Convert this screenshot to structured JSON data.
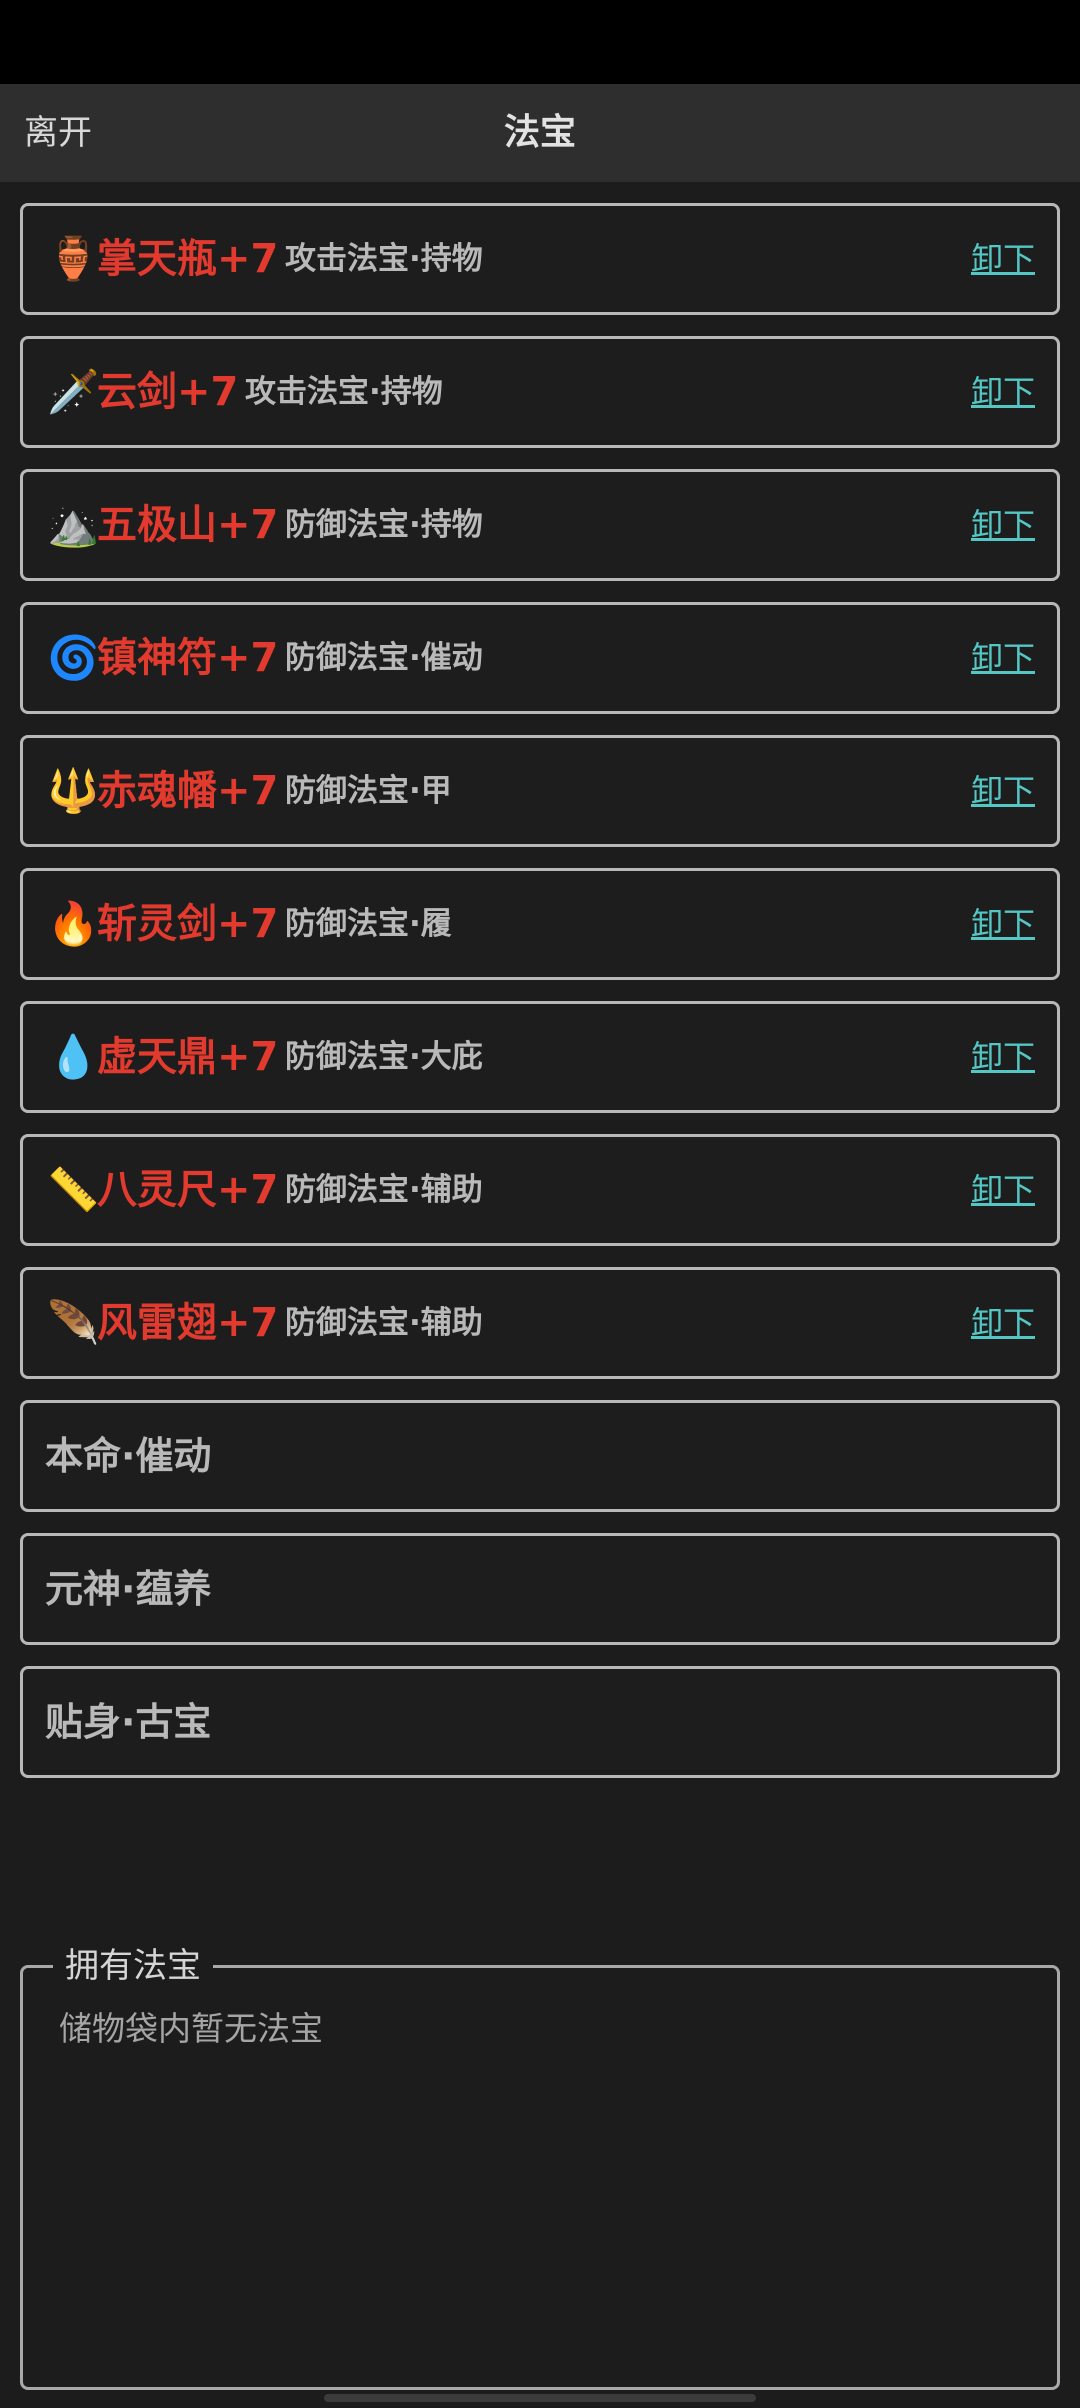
{
  "header": {
    "back_label": "离开",
    "title": "法宝"
  },
  "equipped": [
    {
      "icon": "🏺",
      "icon_name": "amphora-icon",
      "name": "掌天瓶+7",
      "type": "攻击法宝·持物",
      "action": "卸下"
    },
    {
      "icon": "🗡️",
      "icon_name": "dagger-icon",
      "name": "云剑+7",
      "type": "攻击法宝·持物",
      "action": "卸下"
    },
    {
      "icon": "⛰️",
      "icon_name": "mountain-icon",
      "name": "五极山+7",
      "type": "防御法宝·持物",
      "action": "卸下"
    },
    {
      "icon": "🌀",
      "icon_name": "cyclone-icon",
      "name": "镇神符+7",
      "type": "防御法宝·催动",
      "action": "卸下"
    },
    {
      "icon": "🔱",
      "icon_name": "trident-icon",
      "name": "赤魂幡+7",
      "type": "防御法宝·甲",
      "action": "卸下"
    },
    {
      "icon": "🔥",
      "icon_name": "fire-icon",
      "name": "斩灵剑+7",
      "type": "防御法宝·履",
      "action": "卸下"
    },
    {
      "icon": "💧",
      "icon_name": "droplet-icon",
      "name": "虚天鼎+7",
      "type": "防御法宝·大庇",
      "action": "卸下"
    },
    {
      "icon": "📏",
      "icon_name": "ruler-icon",
      "name": "八灵尺+7",
      "type": "防御法宝·辅助",
      "action": "卸下"
    },
    {
      "icon": "🪶",
      "icon_name": "feather-icon",
      "name": "风雷翅+7",
      "type": "防御法宝·辅助",
      "action": "卸下"
    }
  ],
  "empty_slots": [
    {
      "label": "本命·催动"
    },
    {
      "label": "元神·蕴养"
    },
    {
      "label": "贴身·古宝"
    }
  ],
  "owned": {
    "legend": "拥有法宝",
    "empty_text": "储物袋内暂无法宝"
  },
  "colors": {
    "item_name": "#e23a2e",
    "action_link": "#54c6c4",
    "background": "#1b1c1b"
  }
}
